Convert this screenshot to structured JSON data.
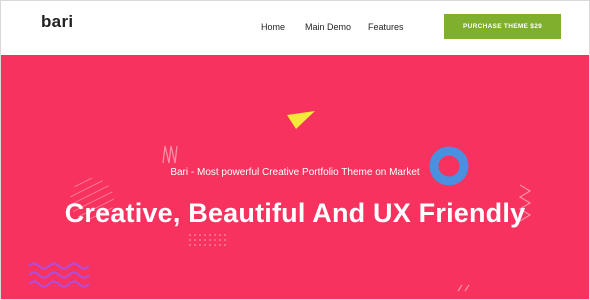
{
  "brand": {
    "logo_text": "bari"
  },
  "nav": {
    "links": [
      "Home",
      "Main Demo",
      "Features"
    ],
    "purchase_label": "PURCHASE THEME $29"
  },
  "hero": {
    "subtitle": "Bari - Most powerful Creative Portfolio Theme on Market",
    "title": "Creative, Beautiful And UX Friendly"
  },
  "colors": {
    "hero_background": "#f7325e",
    "purchase_button": "#7eb02d",
    "triangle": "#f5e93a",
    "ring": "#4a8fe0",
    "wave": "#b64bd6"
  },
  "icons": {
    "triangle": "yellow-triangle-decoration",
    "ring": "blue-ring-decoration",
    "waves": "zigzag-wave-decoration"
  }
}
